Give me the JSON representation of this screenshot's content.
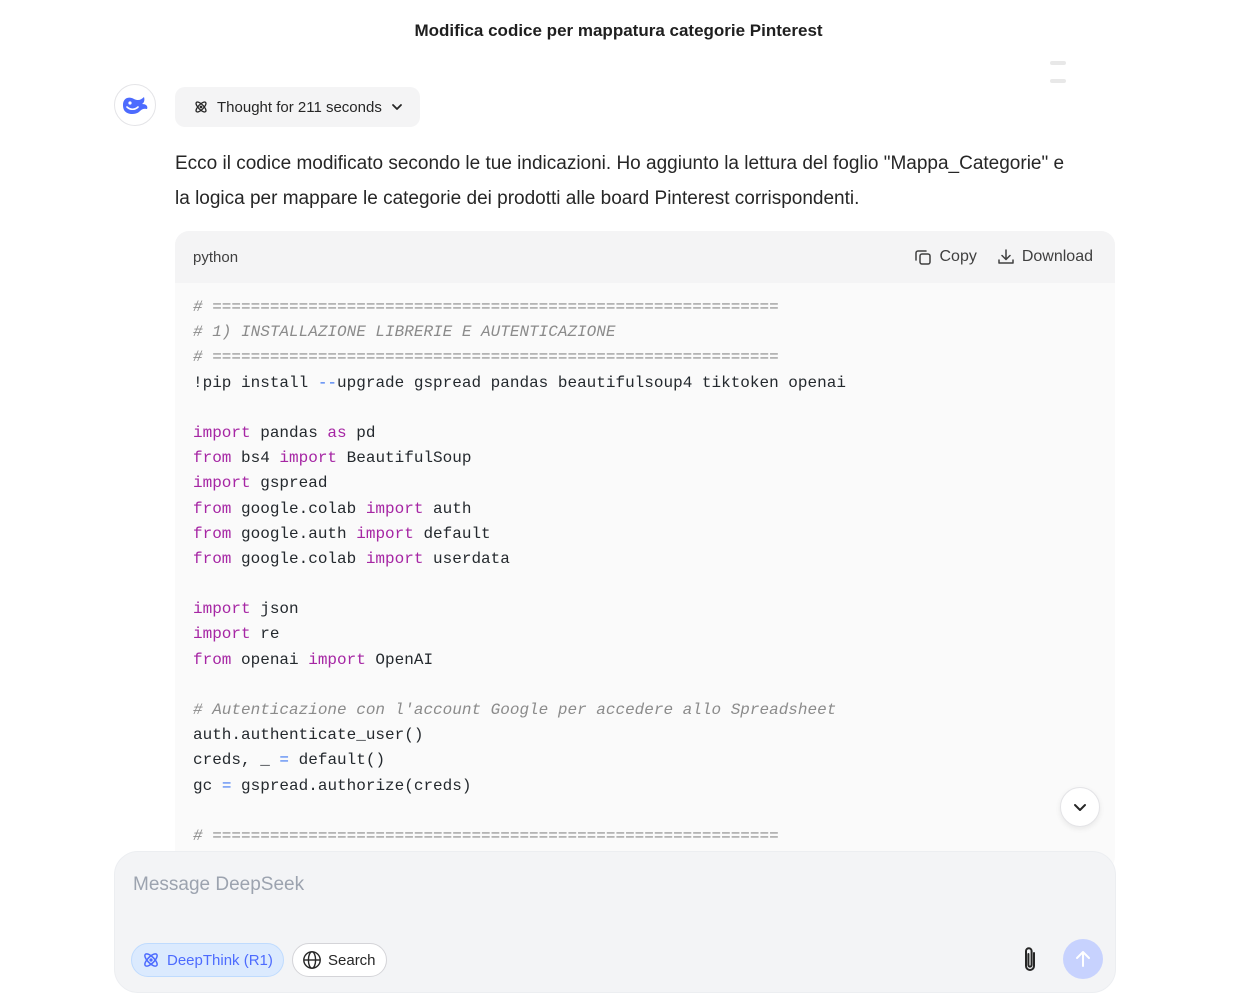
{
  "header": {
    "title": "Modifica codice per mappatura categorie Pinterest"
  },
  "thought": {
    "label": "Thought for 211 seconds"
  },
  "reply": {
    "line1": "Ecco il codice modificato secondo le tue indicazioni. Ho aggiunto la lettura del foglio \"Mappa_Categorie\" e",
    "line2": "la logica per mappare le categorie dei prodotti alle board Pinterest corrispondenti."
  },
  "code_block": {
    "language": "python",
    "copy_label": "Copy",
    "download_label": "Download",
    "lines": [
      [
        [
          "c",
          "# ==========================================================="
        ]
      ],
      [
        [
          "c",
          "# 1) INSTALLAZIONE LIBRERIE E AUTENTICAZIONE"
        ]
      ],
      [
        [
          "c",
          "# ==========================================================="
        ]
      ],
      [
        [
          "t",
          "!pip install "
        ],
        [
          "o",
          "--"
        ],
        [
          "t",
          "upgrade gspread pandas beautifulsoup4 tiktoken openai"
        ]
      ],
      [],
      [
        [
          "k",
          "import"
        ],
        [
          "t",
          " pandas "
        ],
        [
          "k",
          "as"
        ],
        [
          "t",
          " pd"
        ]
      ],
      [
        [
          "k",
          "from"
        ],
        [
          "t",
          " bs4 "
        ],
        [
          "k",
          "import"
        ],
        [
          "t",
          " BeautifulSoup"
        ]
      ],
      [
        [
          "k",
          "import"
        ],
        [
          "t",
          " gspread"
        ]
      ],
      [
        [
          "k",
          "from"
        ],
        [
          "t",
          " google.colab "
        ],
        [
          "k",
          "import"
        ],
        [
          "t",
          " auth"
        ]
      ],
      [
        [
          "k",
          "from"
        ],
        [
          "t",
          " google.auth "
        ],
        [
          "k",
          "import"
        ],
        [
          "t",
          " default"
        ]
      ],
      [
        [
          "k",
          "from"
        ],
        [
          "t",
          " google.colab "
        ],
        [
          "k",
          "import"
        ],
        [
          "t",
          " userdata"
        ]
      ],
      [],
      [
        [
          "k",
          "import"
        ],
        [
          "t",
          " json"
        ]
      ],
      [
        [
          "k",
          "import"
        ],
        [
          "t",
          " re"
        ]
      ],
      [
        [
          "k",
          "from"
        ],
        [
          "t",
          " openai "
        ],
        [
          "k",
          "import"
        ],
        [
          "t",
          " OpenAI"
        ]
      ],
      [],
      [
        [
          "c",
          "# Autenticazione con l'account Google per accedere allo Spreadsheet"
        ]
      ],
      [
        [
          "t",
          "auth.authenticate_user()"
        ]
      ],
      [
        [
          "t",
          "creds, _ "
        ],
        [
          "o",
          "="
        ],
        [
          "t",
          " default()"
        ]
      ],
      [
        [
          "t",
          "gc "
        ],
        [
          "o",
          "="
        ],
        [
          "t",
          " gspread.authorize(creds)"
        ]
      ],
      [],
      [
        [
          "c",
          "# ==========================================================="
        ]
      ]
    ]
  },
  "composer": {
    "placeholder": "Message DeepSeek",
    "deepthink_label": "DeepThink (R1)",
    "search_label": "Search"
  },
  "colors": {
    "accent": "#4d6bfe",
    "keyword": "#a626a4",
    "operator": "#4078f2",
    "comment": "#8b8b8b"
  }
}
